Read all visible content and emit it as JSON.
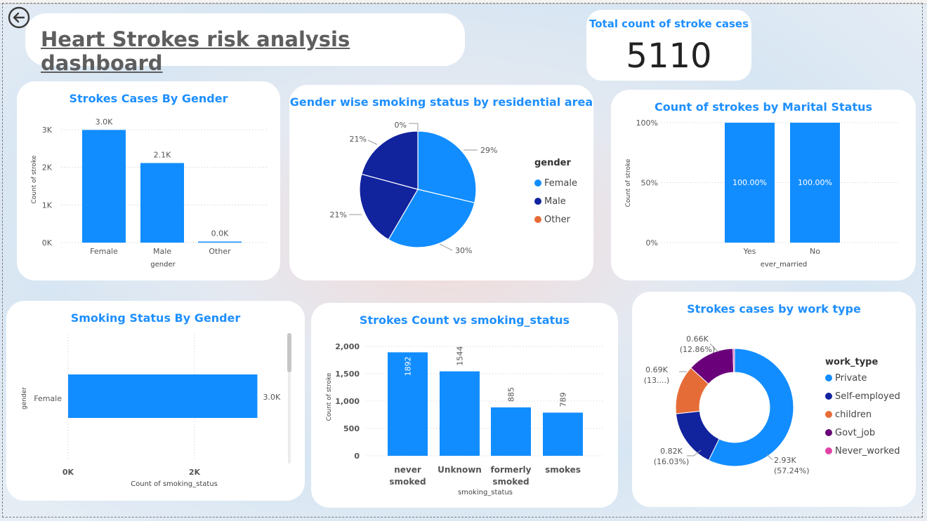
{
  "header": {
    "title": "Heart Strokes risk analysis dashboard"
  },
  "kpi": {
    "label": "Total count of stroke cases",
    "value": "5110"
  },
  "colors": {
    "blue": "#118dff",
    "navy": "#12239e",
    "orange": "#e66c37",
    "purple": "#6b007b",
    "pink": "#e044a7",
    "title_blue": "#1e8fff"
  },
  "charts": {
    "gender": {
      "title": "Strokes Cases By Gender",
      "chart_data": {
        "type": "bar",
        "categories": [
          "Female",
          "Male",
          "Other"
        ],
        "values": [
          2994,
          2115,
          1
        ],
        "data_labels": [
          "3.0K",
          "2.1K",
          "0.0K"
        ],
        "xlabel": "gender",
        "ylabel": "Count of stroke",
        "ylim": [
          0,
          3000
        ],
        "yticks": [
          "0K",
          "1K",
          "2K",
          "3K"
        ],
        "grid": true
      }
    },
    "smoking_pie": {
      "title": "Gender wise smoking status by residential area",
      "chart_data": {
        "type": "pie",
        "legend_title": "gender",
        "legend": [
          "Female",
          "Male",
          "Other"
        ],
        "slices": [
          {
            "value": 29,
            "label": "29%"
          },
          {
            "value": 30,
            "label": "30%"
          },
          {
            "value": 21,
            "label": "21%"
          },
          {
            "value": 21,
            "label": "21%"
          },
          {
            "value": 0,
            "label": "0%"
          }
        ]
      }
    },
    "marital": {
      "title": "Count of strokes by Marital Status",
      "chart_data": {
        "type": "bar",
        "categories": [
          "Yes",
          "No"
        ],
        "values": [
          100,
          100
        ],
        "data_labels": [
          "100.00%",
          "100.00%"
        ],
        "xlabel": "ever_married",
        "ylabel": "Count of stroke",
        "ylim": [
          0,
          100
        ],
        "yticks": [
          "0%",
          "50%",
          "100%"
        ]
      }
    },
    "smoking_gender": {
      "title": "Smoking Status By Gender",
      "chart_data": {
        "type": "bar",
        "orientation": "horizontal",
        "categories": [
          "Female"
        ],
        "values": [
          2994
        ],
        "data_labels": [
          "3.0K"
        ],
        "xlabel": "Count of smoking_status",
        "ylabel": "gender",
        "xlim": [
          0,
          3000
        ],
        "xticks": [
          "0K",
          "2K"
        ]
      }
    },
    "smoking_status": {
      "title": "Strokes Count vs smoking_status",
      "chart_data": {
        "type": "bar",
        "categories": [
          "never smoked",
          "Unknown",
          "formerly smoked",
          "smokes"
        ],
        "values": [
          1892,
          1544,
          885,
          789
        ],
        "xlabel": "smoking_status",
        "ylabel": "Count of stroke",
        "ylim": [
          0,
          2000
        ],
        "yticks": [
          "0",
          "500",
          "1,000",
          "1,500",
          "2,000"
        ]
      }
    },
    "work_type": {
      "title": "Strokes cases by work type",
      "chart_data": {
        "type": "pie",
        "variant": "donut",
        "legend_title": "work_type",
        "legend": [
          "Private",
          "Self-employed",
          "children",
          "Govt_job",
          "Never_worked"
        ],
        "slices": [
          {
            "name": "Private",
            "value": 2925,
            "label1": "2.93K",
            "label2": "(57.24%)"
          },
          {
            "name": "Self-employed",
            "value": 819,
            "label1": "0.82K",
            "label2": "(16.03%)"
          },
          {
            "name": "children",
            "value": 687,
            "label1": "0.69K",
            "label2": "(13....)"
          },
          {
            "name": "Govt_job",
            "value": 657,
            "label1": "0.66K",
            "label2": "(12.86%)"
          },
          {
            "name": "Never_worked",
            "value": 22,
            "label1": "",
            "label2": ""
          }
        ]
      }
    }
  }
}
